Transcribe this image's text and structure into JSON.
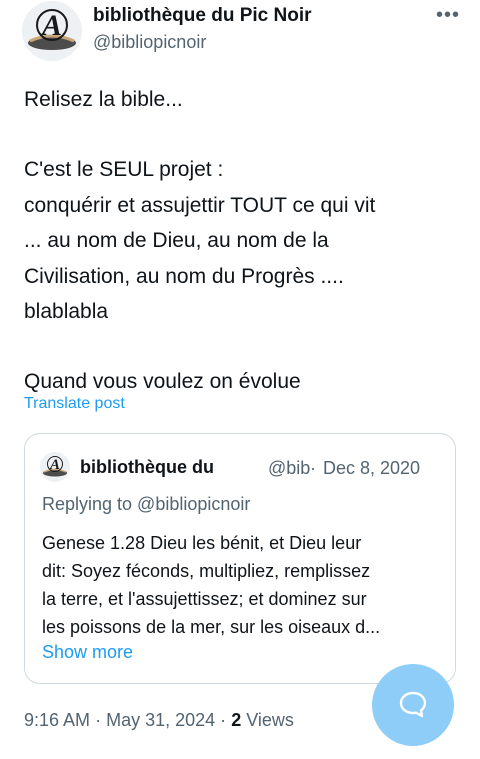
{
  "author": {
    "display_name": "bibliothèque du Pic Noir",
    "handle": "@bibliopicnoir"
  },
  "menu_icon": "more-horizontal-icon",
  "tweet": {
    "lines": [
      "Relisez la bible...",
      "",
      "C'est le SEUL projet :",
      "conquérir et assujettir TOUT ce qui vit",
      "... au nom de Dieu, au nom de la",
      "Civilisation, au nom du Progrès ....",
      "blablabla",
      "",
      "Quand vous voulez on évolue"
    ],
    "translate_label": "Translate post"
  },
  "quote": {
    "display_name": "bibliothèque du",
    "handle": "@bib",
    "separator": "·",
    "date": "Dec 8, 2020",
    "replying_to": "Replying to @bibliopicnoir",
    "lines": [
      "Genese 1.28 Dieu les bénit, et Dieu leur",
      "dit: Soyez féconds, multipliez, remplissez",
      "la terre, et l'assujettissez; et dominez sur",
      "les poissons de la mer, sur les oiseaux d..."
    ],
    "show_more": "Show more"
  },
  "meta": {
    "time": "9:16 AM",
    "separator": "·",
    "date": "May 31, 2024",
    "views_count": "2",
    "views_label": "Views"
  },
  "fab": {
    "icon": "compose-reply-icon",
    "color": "#8ecdf7"
  },
  "colors": {
    "accent": "#1d9bf0",
    "secondary_text": "#536471",
    "primary_text": "#0f1419",
    "border": "#cfd9de"
  }
}
